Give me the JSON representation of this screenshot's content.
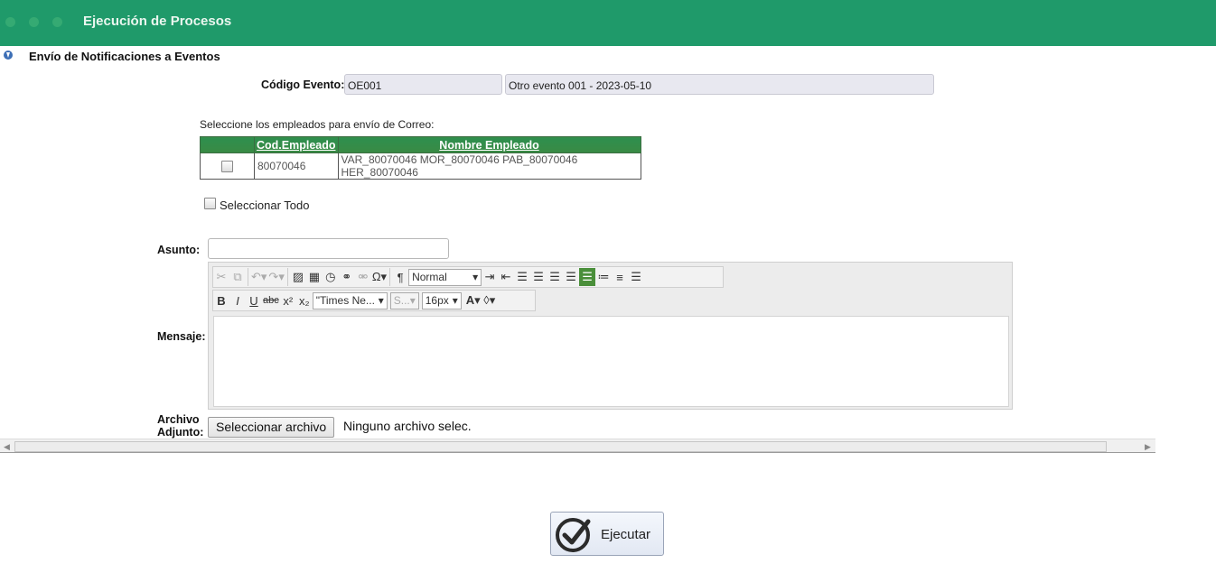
{
  "window": {
    "title": "Ejecución de Procesos"
  },
  "section": {
    "title": "Envío de Notificaciones a Eventos"
  },
  "evento": {
    "label": "Código Evento:",
    "code": "OE001",
    "description": "Otro evento 001 - 2023-05-10"
  },
  "empleados": {
    "instruction": "Seleccione los empleados para envío de Correo:",
    "columns": [
      "Cod.Empleado",
      "Nombre Empleado"
    ],
    "rows": [
      {
        "code": "80070046",
        "name": "VAR_80070046 MOR_80070046 PAB_80070046 HER_80070046"
      }
    ],
    "select_all": "Seleccionar Todo"
  },
  "asunto": {
    "label": "Asunto:",
    "value": ""
  },
  "mensaje": {
    "label": "Mensaje:",
    "format_select": "Normal",
    "font_select": "\"Times Ne...",
    "style_select": "S...",
    "size_select": "16px"
  },
  "archivo": {
    "label_line1": "Archivo",
    "label_line2": "Adjunto:",
    "button": "Seleccionar archivo",
    "status": "Ninguno archivo selec."
  },
  "actions": {
    "execute": "Ejecutar"
  },
  "colors": {
    "header": "#1f9a6a",
    "table_header": "#2e8f4e",
    "active_tool": "#4a8f3a"
  }
}
